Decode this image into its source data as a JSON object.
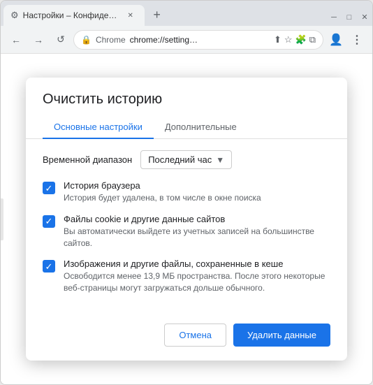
{
  "browser": {
    "tab_title": "Настройки – Конфиденциально…",
    "new_tab_symbol": "+",
    "address_bar": {
      "lock_icon": "🔒",
      "chrome_label": "Chrome",
      "url_text": "chrome://setting…",
      "share_icon": "⬆",
      "star_icon": "☆",
      "puzzle_icon": "🧩",
      "copy_icon": "⧉",
      "avatar_icon": "👤",
      "menu_icon": "⋮"
    },
    "nav": {
      "back": "←",
      "forward": "→",
      "refresh": "↺"
    },
    "window_controls": {
      "minimize": "─",
      "maximize": "□",
      "close": "✕"
    }
  },
  "dialog": {
    "title": "Очистить историю",
    "tabs": [
      {
        "label": "Основные настройки",
        "active": true
      },
      {
        "label": "Дополнительные",
        "active": false
      }
    ],
    "time_range": {
      "label": "Временной диапазон",
      "value": "Последний час",
      "arrow": "▼"
    },
    "checkboxes": [
      {
        "id": "history",
        "checked": true,
        "title": "История браузера",
        "desc": "История будет удалена, в том числе в окне поиска"
      },
      {
        "id": "cookies",
        "checked": true,
        "title": "Файлы cookie и другие данные сайтов",
        "desc": "Вы автоматически выйдете из учетных записей на большинстве сайтов."
      },
      {
        "id": "cache",
        "checked": true,
        "title": "Изображения и другие файлы, сохраненные в кеше",
        "desc": "Освободится менее 13,9 МБ пространства. После этого некоторые веб-страницы могут загружаться дольше обычного."
      }
    ],
    "footer": {
      "cancel_label": "Отмена",
      "delete_label": "Удалить данные"
    }
  }
}
